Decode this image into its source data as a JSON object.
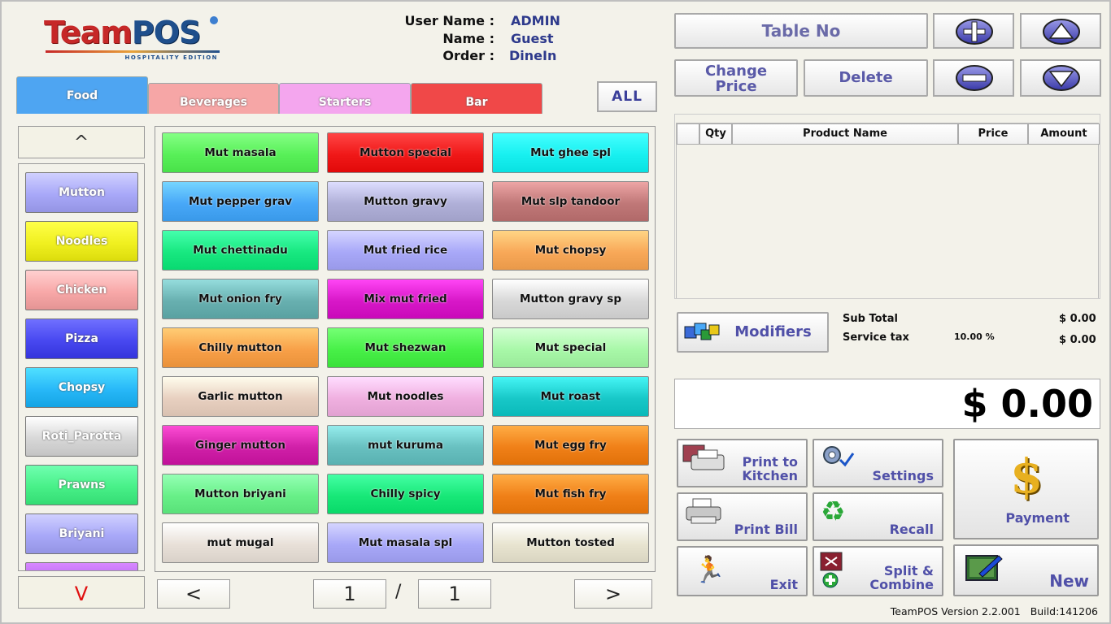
{
  "header": {
    "logo": {
      "brand_a": "Team",
      "brand_b": "POS",
      "edition": "HOSPITALITY EDITION"
    },
    "user_name_label": "User Name :",
    "user_name_value": "ADMIN",
    "name_label": "Name :",
    "name_value": "Guest",
    "order_label": "Order :",
    "order_value": "DineIn"
  },
  "categories": {
    "tabs": [
      {
        "label": "Food",
        "color": "#4ea5f2",
        "active": true
      },
      {
        "label": "Beverages",
        "color": "#f6a6a6",
        "active": false
      },
      {
        "label": "Starters",
        "color": "#f4a6ee",
        "active": false
      },
      {
        "label": "Bar",
        "color": "#f04848",
        "active": false
      }
    ],
    "all_label": "ALL"
  },
  "subcategories": {
    "up_label": "^",
    "down_label": "V",
    "items": [
      {
        "label": "Mutton",
        "color": "#a8a8f8"
      },
      {
        "label": "Noodles",
        "color": "#f0f020"
      },
      {
        "label": "Chicken",
        "color": "#f8a8a8"
      },
      {
        "label": "Pizza",
        "color": "#4848f0"
      },
      {
        "label": "Chopsy",
        "color": "#28b8f8"
      },
      {
        "label": "Roti_Parotta",
        "color": "#d8d8d8"
      },
      {
        "label": "Prawns",
        "color": "#48f088"
      },
      {
        "label": "Briyani",
        "color": "#a8a8f8"
      },
      {
        "label": "",
        "color": "#b060f0"
      }
    ]
  },
  "products": [
    {
      "label": "Mut masala",
      "color": "#58f058"
    },
    {
      "label": "Mutton special",
      "color": "#f01818"
    },
    {
      "label": "Mut ghee spl",
      "color": "#18f0f0"
    },
    {
      "label": "Mut pepper grav",
      "color": "#48a8f8"
    },
    {
      "label": "Mutton gravy",
      "color": "#b0b0d8"
    },
    {
      "label": "Mut slp tandoor",
      "color": "#c07878"
    },
    {
      "label": "Mut chettinadu",
      "color": "#18e880"
    },
    {
      "label": "Mut fried rice",
      "color": "#a8a8f8"
    },
    {
      "label": "Mut chopsy",
      "color": "#f8a858"
    },
    {
      "label": "Mut onion fry",
      "color": "#68b0b0"
    },
    {
      "label": "Mix mut fried",
      "color": "#d818c8"
    },
    {
      "label": "Mutton gravy sp",
      "color": "#d8d8d8"
    },
    {
      "label": "Chilly mutton",
      "color": "#f8a048"
    },
    {
      "label": "Mut shezwan",
      "color": "#48f048"
    },
    {
      "label": "Mut special",
      "color": "#a8f8a8"
    },
    {
      "label": "Garlic mutton",
      "color": "#e8d0c0"
    },
    {
      "label": "Mut noodles",
      "color": "#f0b0e0"
    },
    {
      "label": "Mut roast",
      "color": "#18c8c8"
    },
    {
      "label": "Ginger mutton",
      "color": "#d020a8"
    },
    {
      "label": "mut kuruma",
      "color": "#68c0c0"
    },
    {
      "label": "Mut egg fry",
      "color": "#f08018"
    },
    {
      "label": "Mutton briyani",
      "color": "#68f088"
    },
    {
      "label": "Chilly spicy",
      "color": "#18e878"
    },
    {
      "label": "Mut fish fry",
      "color": "#f08018"
    },
    {
      "label": "mut mugal",
      "color": "#e8e0d8"
    },
    {
      "label": "Mut masala spl",
      "color": "#a8a8f8"
    },
    {
      "label": "Mutton tosted",
      "color": "#e8e4d0"
    }
  ],
  "pager": {
    "prev": "<",
    "next": ">",
    "current": "1",
    "separator": "/",
    "total": "1"
  },
  "order_panel": {
    "table_no_label": "Table No",
    "change_price_label_1": "Change",
    "change_price_label_2": "Price",
    "delete_label": "Delete",
    "columns": [
      "Qty",
      "Product Name",
      "Price",
      "Amount"
    ],
    "rows": [],
    "modifiers_label": "Modifiers",
    "sub_total_label": "Sub Total",
    "sub_total_value": "$ 0.00",
    "service_tax_label": "Service tax",
    "service_tax_rate": "10.00 %",
    "service_tax_value": "$ 0.00",
    "grand_total": "$ 0.00"
  },
  "actions": {
    "print_kitchen_1": "Print to",
    "print_kitchen_2": "Kitchen",
    "settings": "Settings",
    "payment": "Payment",
    "print_bill": "Print Bill",
    "recall": "Recall",
    "exit": "Exit",
    "split_1": "Split &",
    "split_2": "Combine",
    "new": "New"
  },
  "footer": {
    "version": "TeamPOS Version 2.2.001",
    "build": "Build:141206"
  }
}
